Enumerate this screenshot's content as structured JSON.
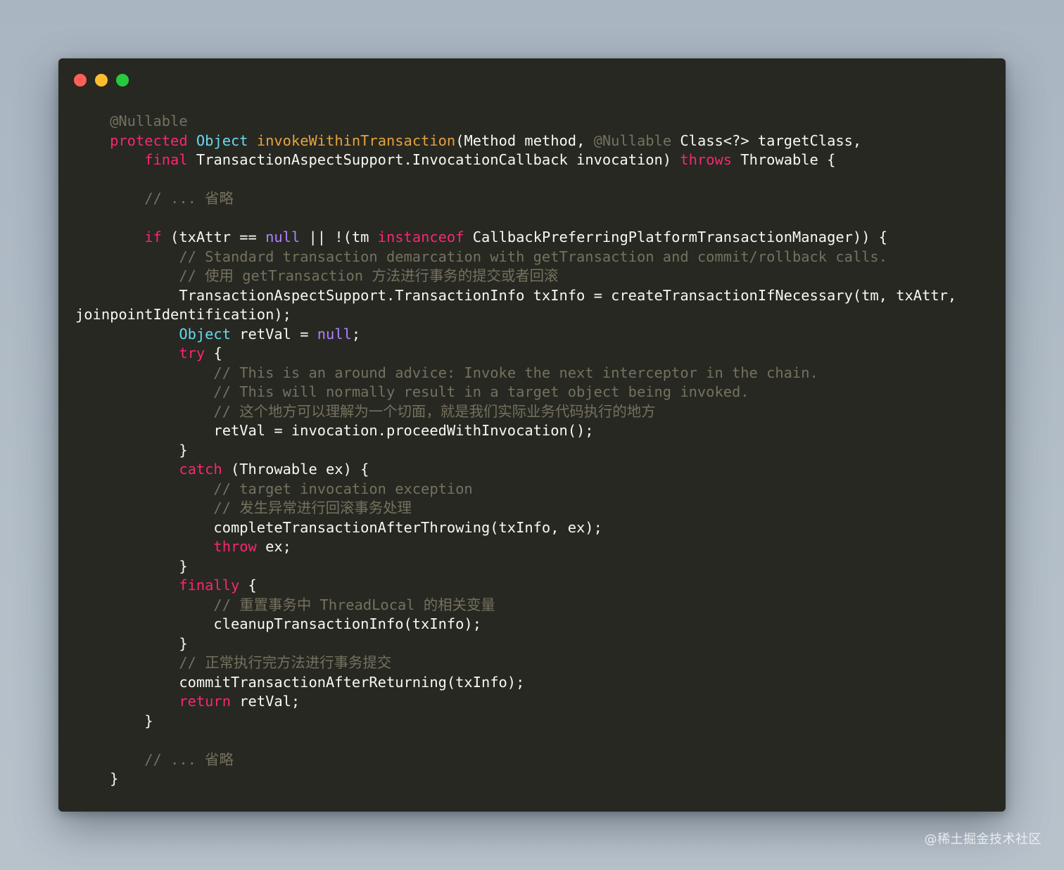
{
  "window": {
    "traffic_lights": [
      {
        "name": "close",
        "color": "#ff5f56"
      },
      {
        "name": "minimize",
        "color": "#ffbd2e"
      },
      {
        "name": "zoom",
        "color": "#27c93f"
      }
    ]
  },
  "colors": {
    "background": "#272822",
    "keyword": "#f92672",
    "type": "#66d9ef",
    "function": "#e6a23c",
    "comment": "#75715e",
    "literal": "#ae81ff",
    "plain": "#f8f8f2"
  },
  "code_lines": [
    [
      {
        "t": "    "
      },
      {
        "t": "@Nullable",
        "c": "ann"
      }
    ],
    [
      {
        "t": "    "
      },
      {
        "t": "protected",
        "c": "kw"
      },
      {
        "t": " "
      },
      {
        "t": "Object",
        "c": "type"
      },
      {
        "t": " "
      },
      {
        "t": "invokeWithinTransaction",
        "c": "fn"
      },
      {
        "t": "(Method method, "
      },
      {
        "t": "@Nullable",
        "c": "ann"
      },
      {
        "t": " Class<?> targetClass,"
      }
    ],
    [
      {
        "t": "        "
      },
      {
        "t": "final",
        "c": "kw"
      },
      {
        "t": " TransactionAspectSupport.InvocationCallback invocation) "
      },
      {
        "t": "throws",
        "c": "kw"
      },
      {
        "t": " Throwable {"
      }
    ],
    [],
    [
      {
        "t": "        "
      },
      {
        "t": "// ... 省略",
        "c": "cm"
      }
    ],
    [],
    [
      {
        "t": "        "
      },
      {
        "t": "if",
        "c": "kw"
      },
      {
        "t": " (txAttr == "
      },
      {
        "t": "null",
        "c": "lit"
      },
      {
        "t": " || !(tm "
      },
      {
        "t": "instanceof",
        "c": "kw"
      },
      {
        "t": " CallbackPreferringPlatformTransactionManager)) {"
      }
    ],
    [
      {
        "t": "            "
      },
      {
        "t": "// Standard transaction demarcation with getTransaction and commit/rollback calls.",
        "c": "cm"
      }
    ],
    [
      {
        "t": "            "
      },
      {
        "t": "// 使用 getTransaction 方法进行事务的提交或者回滚",
        "c": "cm"
      }
    ],
    [
      {
        "t": "            TransactionAspectSupport.TransactionInfo txInfo = createTransactionIfNecessary(tm, txAttr,"
      }
    ],
    [
      {
        "t": "joinpointIdentification);"
      }
    ],
    [
      {
        "t": "            "
      },
      {
        "t": "Object",
        "c": "type"
      },
      {
        "t": " retVal = "
      },
      {
        "t": "null",
        "c": "lit"
      },
      {
        "t": ";"
      }
    ],
    [
      {
        "t": "            "
      },
      {
        "t": "try",
        "c": "kw"
      },
      {
        "t": " {"
      }
    ],
    [
      {
        "t": "                "
      },
      {
        "t": "// This is an around advice: Invoke the next interceptor in the chain.",
        "c": "cm"
      }
    ],
    [
      {
        "t": "                "
      },
      {
        "t": "// This will normally result in a target object being invoked.",
        "c": "cm"
      }
    ],
    [
      {
        "t": "                "
      },
      {
        "t": "// 这个地方可以理解为一个切面，就是我们实际业务代码执行的地方",
        "c": "cm"
      }
    ],
    [
      {
        "t": "                retVal = invocation.proceedWithInvocation();"
      }
    ],
    [
      {
        "t": "            }"
      }
    ],
    [
      {
        "t": "            "
      },
      {
        "t": "catch",
        "c": "kw"
      },
      {
        "t": " (Throwable ex) {"
      }
    ],
    [
      {
        "t": "                "
      },
      {
        "t": "// target invocation exception",
        "c": "cm"
      }
    ],
    [
      {
        "t": "                "
      },
      {
        "t": "// 发生异常进行回滚事务处理",
        "c": "cm"
      }
    ],
    [
      {
        "t": "                completeTransactionAfterThrowing(txInfo, ex);"
      }
    ],
    [
      {
        "t": "                "
      },
      {
        "t": "throw",
        "c": "kw"
      },
      {
        "t": " ex;"
      }
    ],
    [
      {
        "t": "            }"
      }
    ],
    [
      {
        "t": "            "
      },
      {
        "t": "finally",
        "c": "kw"
      },
      {
        "t": " {"
      }
    ],
    [
      {
        "t": "                "
      },
      {
        "t": "// 重置事务中 ThreadLocal 的相关变量",
        "c": "cm"
      }
    ],
    [
      {
        "t": "                cleanupTransactionInfo(txInfo);"
      }
    ],
    [
      {
        "t": "            }"
      }
    ],
    [
      {
        "t": "            "
      },
      {
        "t": "// 正常执行完方法进行事务提交",
        "c": "cm"
      }
    ],
    [
      {
        "t": "            commitTransactionAfterReturning(txInfo);"
      }
    ],
    [
      {
        "t": "            "
      },
      {
        "t": "return",
        "c": "kw"
      },
      {
        "t": " retVal;"
      }
    ],
    [
      {
        "t": "        }"
      }
    ],
    [],
    [
      {
        "t": "        "
      },
      {
        "t": "// ... 省略",
        "c": "cm"
      }
    ],
    [
      {
        "t": "    }"
      }
    ]
  ],
  "watermark": "@稀土掘金技术社区"
}
